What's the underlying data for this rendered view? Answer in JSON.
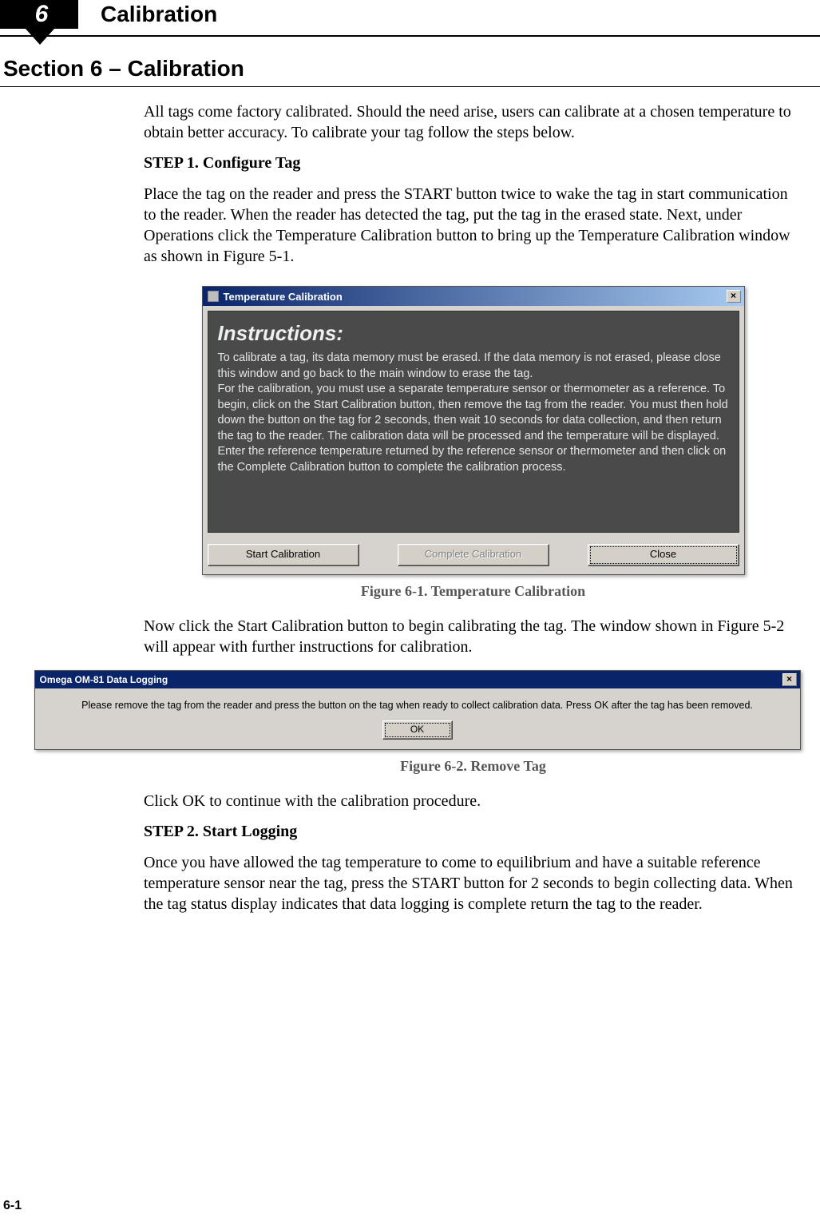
{
  "header": {
    "chapter_number": "6",
    "chapter_title": "Calibration"
  },
  "section": {
    "title": "Section 6 – Calibration"
  },
  "paragraphs": {
    "intro": "All tags come factory calibrated.  Should the need arise, users can calibrate at a chosen temperature to obtain better accuracy. To calibrate your tag follow the steps below.",
    "step1_heading": "STEP 1. Configure Tag",
    "step1_body": "Place the tag on the reader and press the START button twice to wake the tag in start communication to the reader. When the reader has detected the tag, put the tag in the erased state. Next, under Operations click the Temperature Calibration button to bring up the Temperature Calibration window as shown in Figure 5-1.",
    "after_fig1": "Now click the Start Calibration button to begin calibrating the tag. The window shown in Figure 5-2 will appear with further instructions for calibration.",
    "after_fig2": "Click OK to continue with the calibration procedure.",
    "step2_heading": "STEP 2.  Start Logging",
    "step2_body": "Once you have allowed the tag temperature to come to equilibrium and have a suitable reference temperature sensor near the tag, press the START button for 2 seconds to begin collecting data. When the tag status display indicates that data logging is complete return the tag to the reader."
  },
  "dialog1": {
    "title": "Temperature Calibration",
    "close_glyph": "×",
    "instructions_heading": "Instructions:",
    "instructions_body": "To calibrate a tag, its data memory must be erased. If the data memory is not erased, please close this window and go back to the main window to erase the tag.\nFor the calibration, you must use a separate temperature sensor or thermometer as a reference. To begin, click on the Start Calibration button, then remove the tag from the reader. You must then hold down the button on the tag for 2 seconds, then wait 10 seconds for data collection, and then return the tag to the reader. The calibration data will be processed and the temperature will be displayed. Enter the reference temperature returned by the reference sensor or thermometer and then click on the Complete Calibration button to complete the calibration process.",
    "buttons": {
      "start": "Start Calibration",
      "complete": "Complete Calibration",
      "close": "Close"
    }
  },
  "fig1_caption": "Figure 6-1.  Temperature Calibration",
  "dialog2": {
    "title": "Omega OM-81 Data Logging",
    "close_glyph": "×",
    "message": "Please remove the tag from the reader and press the button on the tag when ready to collect calibration data. Press OK after the tag has been removed.",
    "ok_label": "OK"
  },
  "fig2_caption": "Figure 6-2.  Remove Tag",
  "page_number": "6-1"
}
